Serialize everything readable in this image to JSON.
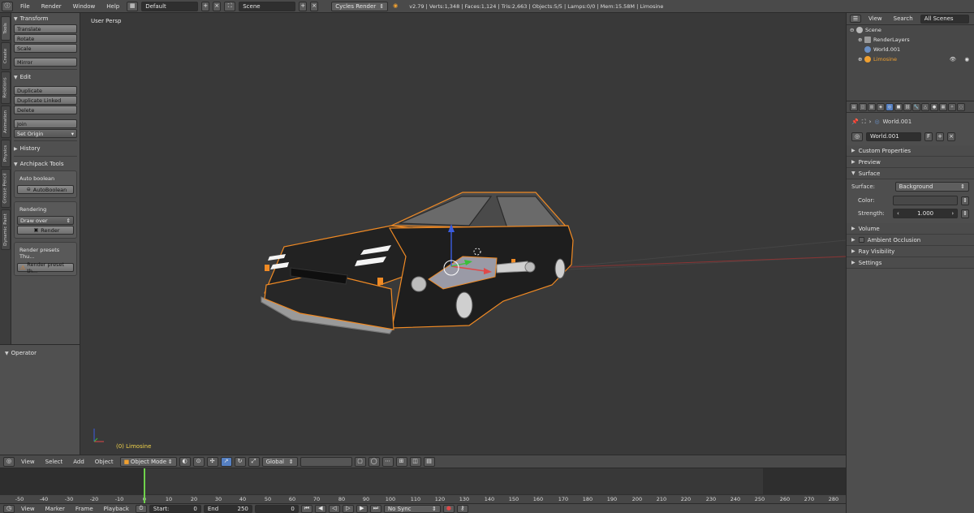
{
  "topbar": {
    "menu": [
      "File",
      "Render",
      "Window",
      "Help"
    ],
    "layout": "Default",
    "scene": "Scene",
    "engine": "Cycles Render",
    "stats": "v2.79 | Verts:1,348 | Faces:1,124 | Tris:2,663 | Objects:5/5 | Lamps:0/0 | Mem:15.58M | Limosine"
  },
  "side_tabs": [
    "Tools",
    "Create",
    "Relations",
    "Animation",
    "Physics",
    "Grease Pencil",
    "Dynamic Paint"
  ],
  "shelf": {
    "transform": {
      "title": "Transform",
      "buttons": [
        "Translate",
        "Rotate",
        "Scale",
        "Mirror"
      ]
    },
    "edit": {
      "title": "Edit",
      "buttons": [
        "Duplicate",
        "Duplicate Linked",
        "Delete",
        "Join"
      ],
      "set_origin": "Set Origin"
    },
    "history": "History",
    "archipack": {
      "title": "Archipack Tools",
      "auto_boolean_label": "Auto boolean",
      "auto_boolean_button": "AutoBoolean",
      "rendering_label": "Rendering",
      "draw_over": "Draw over",
      "render_button": "Render",
      "presets_label": "Render presets Thu...",
      "presets_button": "Render preset th..."
    },
    "operator": "Operator"
  },
  "viewport": {
    "label": "User Persp",
    "object_label": "(0) Limosine"
  },
  "viewport_header": {
    "menus": [
      "View",
      "Select",
      "Add",
      "Object"
    ],
    "mode": "Object Mode",
    "orientation": "Global"
  },
  "timeline": {
    "ticks": [
      "-50",
      "-40",
      "-30",
      "-20",
      "-10",
      "0",
      "10",
      "20",
      "30",
      "40",
      "50",
      "60",
      "70",
      "80",
      "90",
      "100",
      "110",
      "120",
      "130",
      "140",
      "150",
      "160",
      "170",
      "180",
      "190",
      "200",
      "210",
      "220",
      "230",
      "240",
      "250",
      "260",
      "270",
      "280"
    ],
    "current_frame": 0
  },
  "timeline_header": {
    "menus": [
      "View",
      "Marker",
      "Frame",
      "Playback"
    ],
    "start_label": "Start:",
    "start": "0",
    "end_label": "End",
    "end": "250",
    "current": "0",
    "sync": "No Sync"
  },
  "outliner": {
    "header": [
      "View",
      "Search"
    ],
    "filter": "All Scenes",
    "items": [
      "Scene",
      "RenderLayers",
      "World.001",
      "Limosine"
    ]
  },
  "properties": {
    "breadcrumb": "World.001",
    "world_name": "World.001",
    "fake_user": "F",
    "panels": {
      "custom_properties": "Custom Properties",
      "preview": "Preview",
      "surface": "Surface",
      "volume": "Volume",
      "ambient_occlusion": "Ambient Occlusion",
      "ray_visibility": "Ray Visibility",
      "settings": "Settings"
    },
    "surface_label": "Surface:",
    "surface_value": "Background",
    "color_label": "Color:",
    "strength_label": "Strength:",
    "strength_value": "1.000"
  },
  "colors": {
    "ui_bg": "#393939",
    "accent_blue": "#5680c2",
    "selected_orange": "#f08a24",
    "frame_cursor": "#6fd24b",
    "object_label": "#f0d24a"
  }
}
